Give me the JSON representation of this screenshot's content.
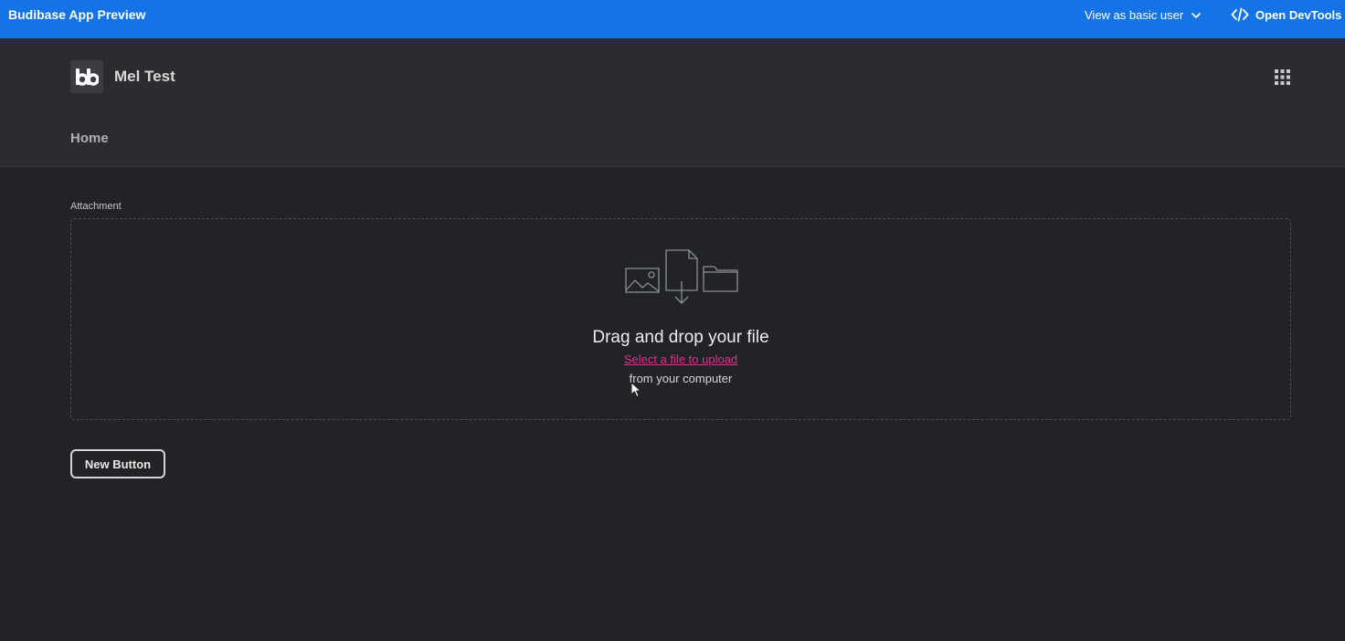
{
  "devbar": {
    "title": "Budibase App Preview",
    "role_label": "View as basic user",
    "devtools_label": "Open DevTools",
    "background_color": "#1473e6"
  },
  "app": {
    "logo_icon": "budibase-logo-icon",
    "name": "Mel Test",
    "apps_icon": "app-grid-icon"
  },
  "nav": {
    "home_label": "Home"
  },
  "attachment": {
    "label": "Attachment",
    "heading": "Drag and drop your file",
    "select_link": "Select a file to upload",
    "subtext": "from your computer",
    "link_color": "#d6338e"
  },
  "button": {
    "label": "New Button"
  }
}
